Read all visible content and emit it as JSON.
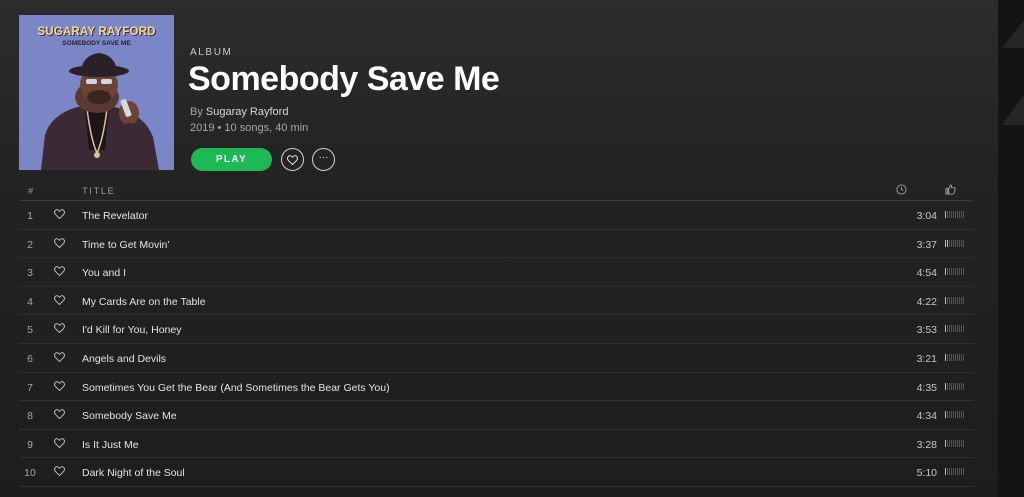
{
  "album": {
    "type_label": "ALBUM",
    "title": "Somebody Save Me",
    "by_prefix": "By",
    "artist": "Sugaray Rayford",
    "meta": "2019 • 10 songs, 40 min",
    "cover_artist": "SUGARAY RAYFORD",
    "cover_title": "SOMEBODY SAVE ME"
  },
  "actions": {
    "play_label": "PLAY",
    "like_icon": "heart-icon",
    "more_icon": "more-icon",
    "more_glyph": "···"
  },
  "tracklist": {
    "header": {
      "number": "#",
      "title": "TITLE",
      "duration_icon": "clock-icon",
      "popularity_icon": "thumbs-up-icon"
    },
    "tracks": [
      {
        "number": "1",
        "title": "The Revelator",
        "duration": "3:04",
        "popularity": 0.1
      },
      {
        "number": "2",
        "title": "Time to Get Movin'",
        "duration": "3:37",
        "popularity": 0.2
      },
      {
        "number": "3",
        "title": "You and I",
        "duration": "4:54",
        "popularity": 0.1
      },
      {
        "number": "4",
        "title": "My Cards Are on the Table",
        "duration": "4:22",
        "popularity": 0.1
      },
      {
        "number": "5",
        "title": "I'd Kill for You, Honey",
        "duration": "3:53",
        "popularity": 0.1
      },
      {
        "number": "6",
        "title": "Angels and Devils",
        "duration": "3:21",
        "popularity": 0.1
      },
      {
        "number": "7",
        "title": "Sometimes You Get the Bear (And Sometimes the Bear Gets You)",
        "duration": "4:35",
        "popularity": 0.1
      },
      {
        "number": "8",
        "title": "Somebody Save Me",
        "duration": "4:34",
        "popularity": 0.1
      },
      {
        "number": "9",
        "title": "Is It Just Me",
        "duration": "3:28",
        "popularity": 0.1
      },
      {
        "number": "10",
        "title": "Dark Night of the Soul",
        "duration": "5:10",
        "popularity": 0.1
      }
    ]
  },
  "colors": {
    "accent": "#1db954",
    "background": "#232323",
    "text_primary": "#ffffff",
    "text_secondary": "#b3b3b3"
  }
}
